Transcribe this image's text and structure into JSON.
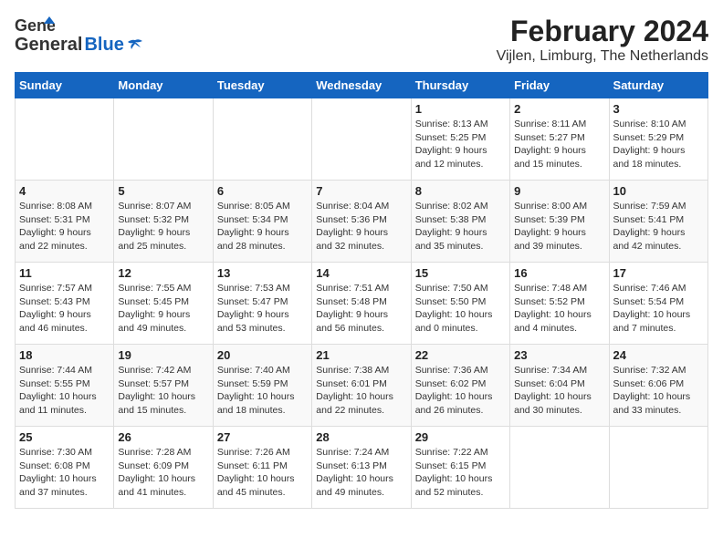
{
  "header": {
    "logo_general": "General",
    "logo_blue": "Blue",
    "title": "February 2024",
    "subtitle": "Vijlen, Limburg, The Netherlands"
  },
  "days_of_week": [
    "Sunday",
    "Monday",
    "Tuesday",
    "Wednesday",
    "Thursday",
    "Friday",
    "Saturday"
  ],
  "weeks": [
    [
      {
        "day": "",
        "info": ""
      },
      {
        "day": "",
        "info": ""
      },
      {
        "day": "",
        "info": ""
      },
      {
        "day": "",
        "info": ""
      },
      {
        "day": "1",
        "info": "Sunrise: 8:13 AM\nSunset: 5:25 PM\nDaylight: 9 hours\nand 12 minutes."
      },
      {
        "day": "2",
        "info": "Sunrise: 8:11 AM\nSunset: 5:27 PM\nDaylight: 9 hours\nand 15 minutes."
      },
      {
        "day": "3",
        "info": "Sunrise: 8:10 AM\nSunset: 5:29 PM\nDaylight: 9 hours\nand 18 minutes."
      }
    ],
    [
      {
        "day": "4",
        "info": "Sunrise: 8:08 AM\nSunset: 5:31 PM\nDaylight: 9 hours\nand 22 minutes."
      },
      {
        "day": "5",
        "info": "Sunrise: 8:07 AM\nSunset: 5:32 PM\nDaylight: 9 hours\nand 25 minutes."
      },
      {
        "day": "6",
        "info": "Sunrise: 8:05 AM\nSunset: 5:34 PM\nDaylight: 9 hours\nand 28 minutes."
      },
      {
        "day": "7",
        "info": "Sunrise: 8:04 AM\nSunset: 5:36 PM\nDaylight: 9 hours\nand 32 minutes."
      },
      {
        "day": "8",
        "info": "Sunrise: 8:02 AM\nSunset: 5:38 PM\nDaylight: 9 hours\nand 35 minutes."
      },
      {
        "day": "9",
        "info": "Sunrise: 8:00 AM\nSunset: 5:39 PM\nDaylight: 9 hours\nand 39 minutes."
      },
      {
        "day": "10",
        "info": "Sunrise: 7:59 AM\nSunset: 5:41 PM\nDaylight: 9 hours\nand 42 minutes."
      }
    ],
    [
      {
        "day": "11",
        "info": "Sunrise: 7:57 AM\nSunset: 5:43 PM\nDaylight: 9 hours\nand 46 minutes."
      },
      {
        "day": "12",
        "info": "Sunrise: 7:55 AM\nSunset: 5:45 PM\nDaylight: 9 hours\nand 49 minutes."
      },
      {
        "day": "13",
        "info": "Sunrise: 7:53 AM\nSunset: 5:47 PM\nDaylight: 9 hours\nand 53 minutes."
      },
      {
        "day": "14",
        "info": "Sunrise: 7:51 AM\nSunset: 5:48 PM\nDaylight: 9 hours\nand 56 minutes."
      },
      {
        "day": "15",
        "info": "Sunrise: 7:50 AM\nSunset: 5:50 PM\nDaylight: 10 hours\nand 0 minutes."
      },
      {
        "day": "16",
        "info": "Sunrise: 7:48 AM\nSunset: 5:52 PM\nDaylight: 10 hours\nand 4 minutes."
      },
      {
        "day": "17",
        "info": "Sunrise: 7:46 AM\nSunset: 5:54 PM\nDaylight: 10 hours\nand 7 minutes."
      }
    ],
    [
      {
        "day": "18",
        "info": "Sunrise: 7:44 AM\nSunset: 5:55 PM\nDaylight: 10 hours\nand 11 minutes."
      },
      {
        "day": "19",
        "info": "Sunrise: 7:42 AM\nSunset: 5:57 PM\nDaylight: 10 hours\nand 15 minutes."
      },
      {
        "day": "20",
        "info": "Sunrise: 7:40 AM\nSunset: 5:59 PM\nDaylight: 10 hours\nand 18 minutes."
      },
      {
        "day": "21",
        "info": "Sunrise: 7:38 AM\nSunset: 6:01 PM\nDaylight: 10 hours\nand 22 minutes."
      },
      {
        "day": "22",
        "info": "Sunrise: 7:36 AM\nSunset: 6:02 PM\nDaylight: 10 hours\nand 26 minutes."
      },
      {
        "day": "23",
        "info": "Sunrise: 7:34 AM\nSunset: 6:04 PM\nDaylight: 10 hours\nand 30 minutes."
      },
      {
        "day": "24",
        "info": "Sunrise: 7:32 AM\nSunset: 6:06 PM\nDaylight: 10 hours\nand 33 minutes."
      }
    ],
    [
      {
        "day": "25",
        "info": "Sunrise: 7:30 AM\nSunset: 6:08 PM\nDaylight: 10 hours\nand 37 minutes."
      },
      {
        "day": "26",
        "info": "Sunrise: 7:28 AM\nSunset: 6:09 PM\nDaylight: 10 hours\nand 41 minutes."
      },
      {
        "day": "27",
        "info": "Sunrise: 7:26 AM\nSunset: 6:11 PM\nDaylight: 10 hours\nand 45 minutes."
      },
      {
        "day": "28",
        "info": "Sunrise: 7:24 AM\nSunset: 6:13 PM\nDaylight: 10 hours\nand 49 minutes."
      },
      {
        "day": "29",
        "info": "Sunrise: 7:22 AM\nSunset: 6:15 PM\nDaylight: 10 hours\nand 52 minutes."
      },
      {
        "day": "",
        "info": ""
      },
      {
        "day": "",
        "info": ""
      }
    ]
  ]
}
